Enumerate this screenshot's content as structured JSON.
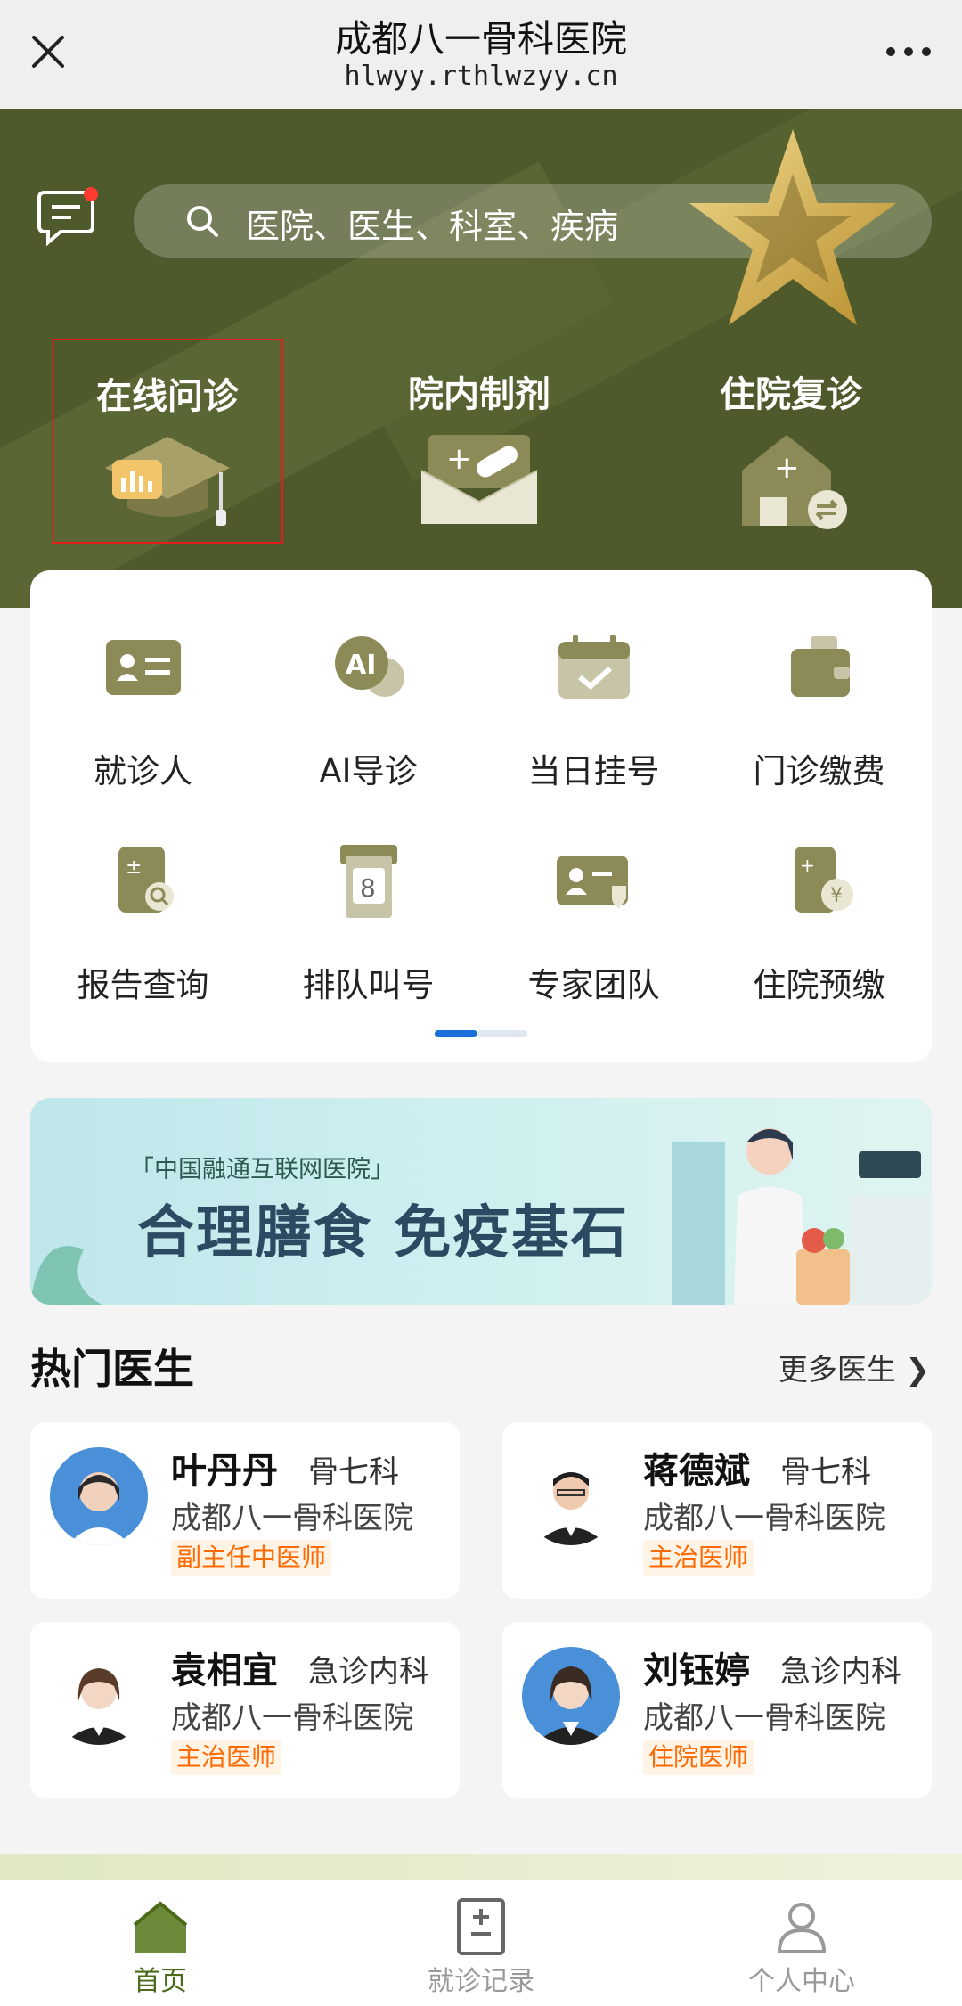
{
  "window": {
    "title": "成都八一骨科医院",
    "url": "hlwyy.rthlwzyy.cn"
  },
  "search": {
    "placeholder": "医院、医生、科室、疾病"
  },
  "quick_actions": [
    {
      "label": "在线问诊",
      "icon": "graduation-cap-chart-icon",
      "selected": true
    },
    {
      "label": "院内制剂",
      "icon": "medicine-envelope-icon",
      "selected": false
    },
    {
      "label": "住院复诊",
      "icon": "house-plus-icon",
      "selected": false
    }
  ],
  "services": [
    {
      "label": "就诊人",
      "icon": "id-card-icon"
    },
    {
      "label": "AI导诊",
      "icon": "ai-chat-icon"
    },
    {
      "label": "当日挂号",
      "icon": "calendar-check-icon"
    },
    {
      "label": "门诊缴费",
      "icon": "wallet-icon"
    },
    {
      "label": "报告查询",
      "icon": "report-search-icon"
    },
    {
      "label": "排队叫号",
      "icon": "queue-number-icon"
    },
    {
      "label": "专家团队",
      "icon": "expert-card-icon"
    },
    {
      "label": "住院预缴",
      "icon": "yuan-payment-icon"
    }
  ],
  "banner": {
    "sub": "「中国融通互联网医院」",
    "main": "合理膳食 免疫基石"
  },
  "popular_doctors": {
    "title": "热门医生",
    "more": "更多医生 ❯",
    "doctors": [
      {
        "name": "叶丹丹",
        "dept": "骨七科",
        "hospital": "成都八一骨科医院",
        "title": "副主任中医师"
      },
      {
        "name": "蒋德斌",
        "dept": "骨七科",
        "hospital": "成都八一骨科医院",
        "title": "主治医师"
      },
      {
        "name": "袁相宜",
        "dept": "急诊内科",
        "hospital": "成都八一骨科医院",
        "title": "主治医师"
      },
      {
        "name": "刘钰婷",
        "dept": "急诊内科",
        "hospital": "成都八一骨科医院",
        "title": "住院医师"
      }
    ]
  },
  "tabbar": [
    {
      "label": "首页",
      "icon": "home-icon",
      "active": true
    },
    {
      "label": "就诊记录",
      "icon": "record-icon",
      "active": false
    },
    {
      "label": "个人中心",
      "icon": "user-icon",
      "active": false
    }
  ],
  "colors": {
    "hero": "#4e5a2c",
    "accent_olive": "#8c8b58",
    "tag_orange": "#ff6a00",
    "active_tab": "#4a6a1a"
  }
}
